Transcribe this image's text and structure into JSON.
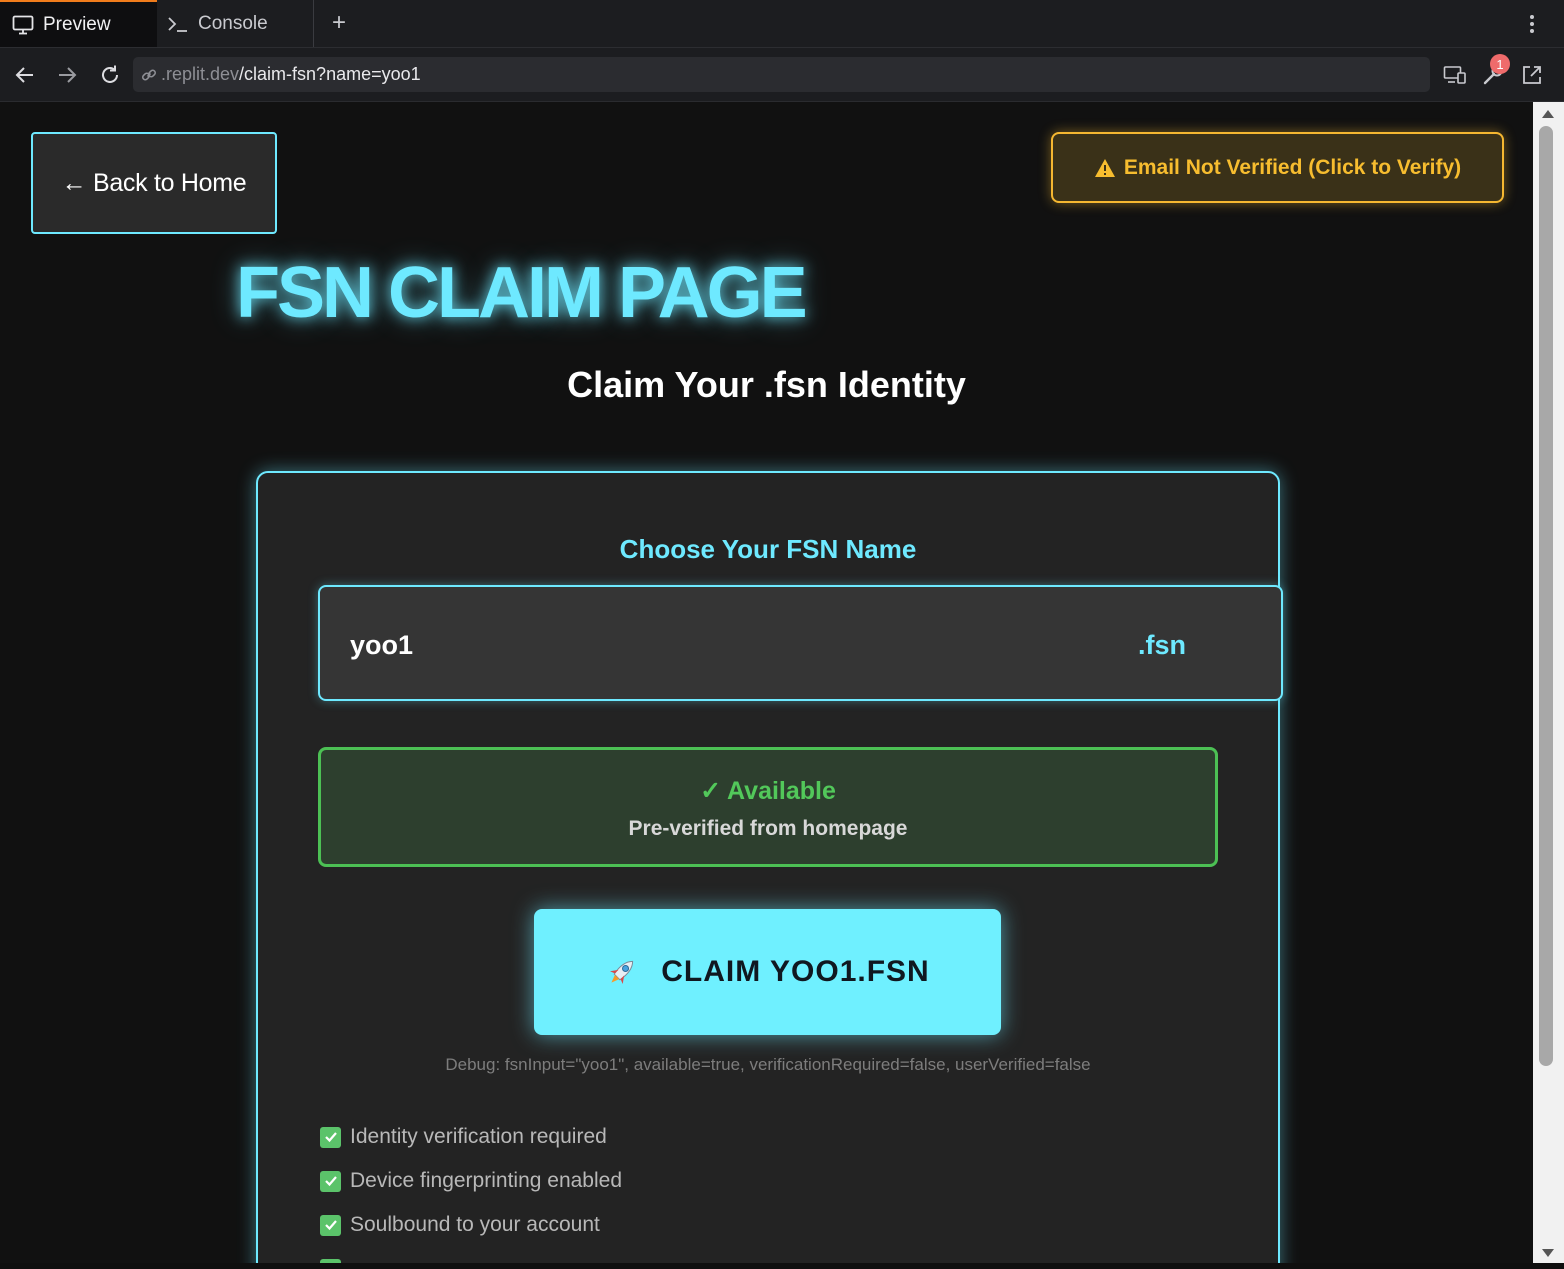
{
  "browser": {
    "tabs": [
      {
        "label": "Preview",
        "icon": "monitor-icon",
        "active": true
      },
      {
        "label": "Console",
        "icon": "terminal-icon",
        "active": false
      }
    ],
    "new_tab_label": "+",
    "url": {
      "dim": ".replit.dev",
      "main": "/claim-fsn?name=yoo1"
    },
    "devtools_badge": "1"
  },
  "page": {
    "back_label": "← Back to Home",
    "verify_label": "Email Not Verified (Click to Verify)",
    "title": "FSN CLAIM PAGE",
    "subtitle": "Claim Your .fsn Identity",
    "card": {
      "choose_label": "Choose Your FSN Name",
      "name_value": "yoo1",
      "suffix": ".fsn",
      "availability": {
        "title": "✓ Available",
        "subtitle": "Pre-verified from homepage"
      },
      "claim_label": "CLAIM YOO1.FSN",
      "debug": "Debug: fsnInput=\"yoo1\", available=true, verificationRequired=false, userVerified=false",
      "features": [
        "Identity verification required",
        "Device fingerprinting enabled",
        "Soulbound to your account"
      ]
    }
  },
  "colors": {
    "accent": "#6ee9ff",
    "warning": "#f5b731",
    "success": "#4cc054",
    "browser_active_tab": "#f07c1c"
  }
}
